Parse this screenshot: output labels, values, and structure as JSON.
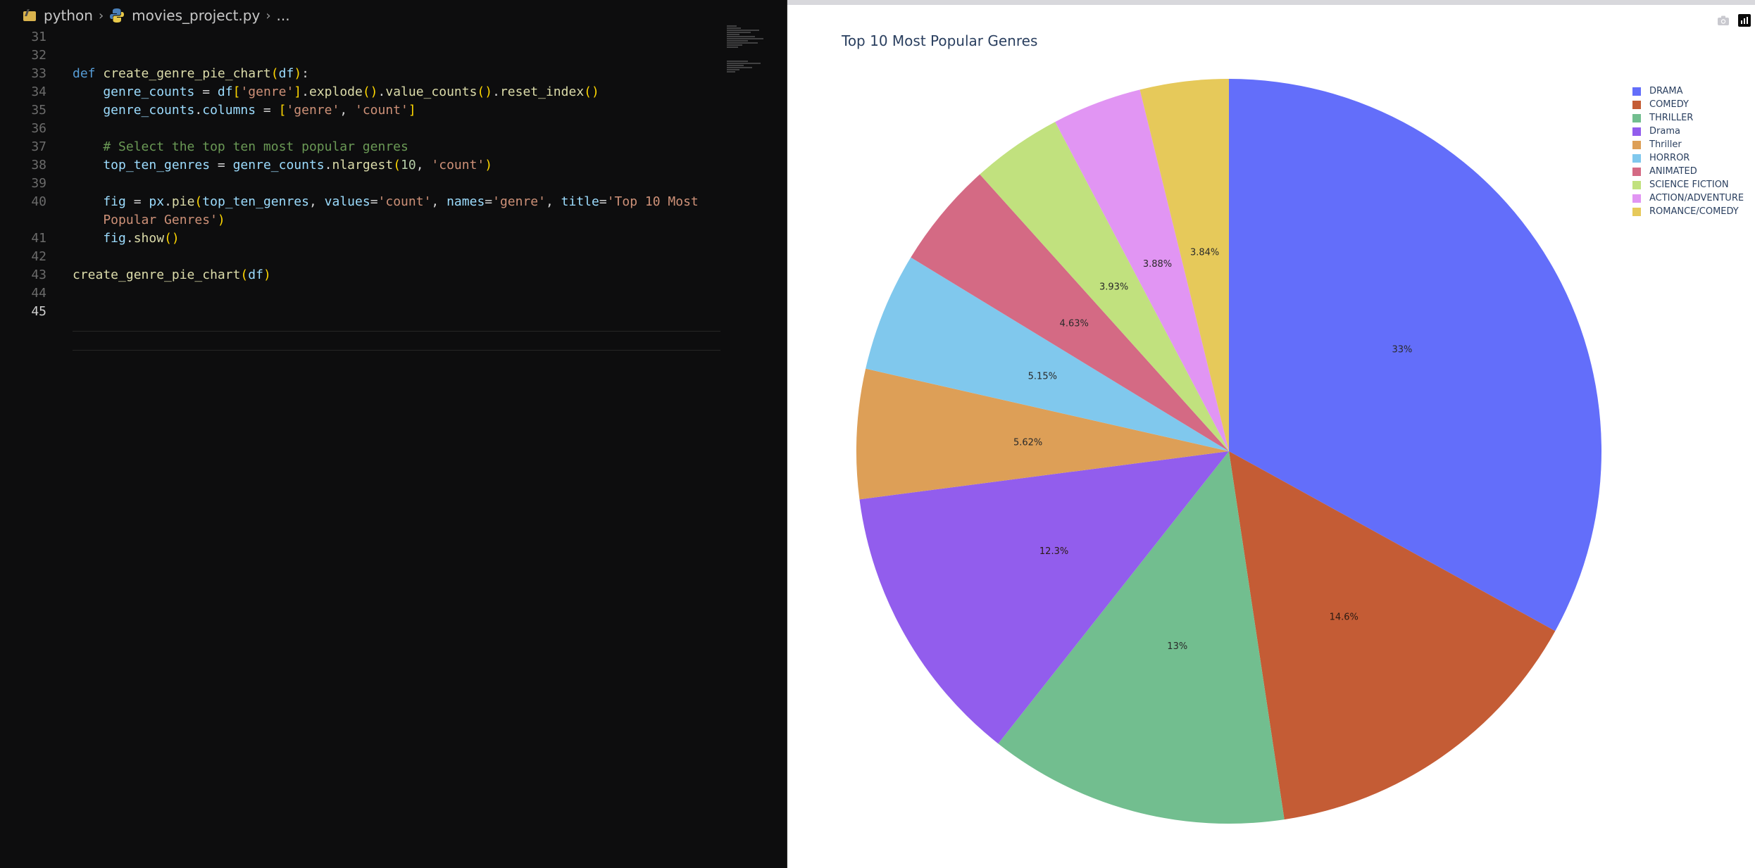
{
  "editor": {
    "breadcrumb": {
      "folder": "python",
      "file": "movies_project.py",
      "more": "..."
    },
    "active_line": "45",
    "lines": [
      {
        "num": "31",
        "tokens": []
      },
      {
        "num": "32",
        "tokens": []
      },
      {
        "num": "33",
        "tokens": [
          {
            "t": "def ",
            "c": "kw"
          },
          {
            "t": "create_genre_pie_chart",
            "c": "fn"
          },
          {
            "t": "(",
            "c": "br1"
          },
          {
            "t": "df",
            "c": "var"
          },
          {
            "t": ")",
            "c": "br1"
          },
          {
            "t": ":",
            "c": ""
          }
        ]
      },
      {
        "num": "34",
        "tokens": [
          {
            "t": "    genre_counts",
            "c": "var"
          },
          {
            "t": " = ",
            "c": ""
          },
          {
            "t": "df",
            "c": "var"
          },
          {
            "t": "[",
            "c": "br1"
          },
          {
            "t": "'genre'",
            "c": "str"
          },
          {
            "t": "]",
            "c": "br1"
          },
          {
            "t": ".",
            "c": ""
          },
          {
            "t": "explode",
            "c": "fn"
          },
          {
            "t": "()",
            "c": "br1"
          },
          {
            "t": ".",
            "c": ""
          },
          {
            "t": "value_counts",
            "c": "fn"
          },
          {
            "t": "()",
            "c": "br1"
          },
          {
            "t": ".",
            "c": ""
          },
          {
            "t": "reset_index",
            "c": "fn"
          },
          {
            "t": "()",
            "c": "br1"
          }
        ]
      },
      {
        "num": "35",
        "tokens": [
          {
            "t": "    genre_counts",
            "c": "var"
          },
          {
            "t": ".",
            "c": ""
          },
          {
            "t": "columns",
            "c": "var"
          },
          {
            "t": " = ",
            "c": ""
          },
          {
            "t": "[",
            "c": "br1"
          },
          {
            "t": "'genre'",
            "c": "str"
          },
          {
            "t": ", ",
            "c": ""
          },
          {
            "t": "'count'",
            "c": "str"
          },
          {
            "t": "]",
            "c": "br1"
          }
        ]
      },
      {
        "num": "36",
        "tokens": []
      },
      {
        "num": "37",
        "tokens": [
          {
            "t": "    # Select the top ten most popular genres",
            "c": "com"
          }
        ]
      },
      {
        "num": "38",
        "tokens": [
          {
            "t": "    top_ten_genres",
            "c": "var"
          },
          {
            "t": " = ",
            "c": ""
          },
          {
            "t": "genre_counts",
            "c": "var"
          },
          {
            "t": ".",
            "c": ""
          },
          {
            "t": "nlargest",
            "c": "fn"
          },
          {
            "t": "(",
            "c": "br1"
          },
          {
            "t": "10",
            "c": "num"
          },
          {
            "t": ", ",
            "c": ""
          },
          {
            "t": "'count'",
            "c": "str"
          },
          {
            "t": ")",
            "c": "br1"
          }
        ]
      },
      {
        "num": "39",
        "tokens": []
      },
      {
        "num": "40",
        "tokens": [
          {
            "t": "    fig",
            "c": "var"
          },
          {
            "t": " = ",
            "c": ""
          },
          {
            "t": "px",
            "c": "var"
          },
          {
            "t": ".",
            "c": ""
          },
          {
            "t": "pie",
            "c": "fn"
          },
          {
            "t": "(",
            "c": "br1"
          },
          {
            "t": "top_ten_genres",
            "c": "var"
          },
          {
            "t": ", ",
            "c": ""
          },
          {
            "t": "values",
            "c": "var"
          },
          {
            "t": "=",
            "c": ""
          },
          {
            "t": "'count'",
            "c": "str"
          },
          {
            "t": ", ",
            "c": ""
          },
          {
            "t": "names",
            "c": "var"
          },
          {
            "t": "=",
            "c": ""
          },
          {
            "t": "'genre'",
            "c": "str"
          },
          {
            "t": ", ",
            "c": ""
          },
          {
            "t": "title",
            "c": "var"
          },
          {
            "t": "=",
            "c": ""
          },
          {
            "t": "'Top 10 Most",
            "c": "str"
          }
        ]
      },
      {
        "num": "",
        "tokens": [
          {
            "t": "    Popular Genres'",
            "c": "str"
          },
          {
            "t": ")",
            "c": "br1"
          }
        ]
      },
      {
        "num": "41",
        "tokens": [
          {
            "t": "    fig",
            "c": "var"
          },
          {
            "t": ".",
            "c": ""
          },
          {
            "t": "show",
            "c": "fn"
          },
          {
            "t": "()",
            "c": "br1"
          }
        ]
      },
      {
        "num": "42",
        "tokens": []
      },
      {
        "num": "43",
        "tokens": [
          {
            "t": "create_genre_pie_chart",
            "c": "fn"
          },
          {
            "t": "(",
            "c": "br1"
          },
          {
            "t": "df",
            "c": "var"
          },
          {
            "t": ")",
            "c": "br1"
          }
        ]
      },
      {
        "num": "44",
        "tokens": []
      },
      {
        "num": "45",
        "tokens": []
      }
    ]
  },
  "chart_data": {
    "type": "pie",
    "title": "Top 10 Most Popular Genres",
    "labels": [
      "DRAMA",
      "COMEDY",
      "THRILLER",
      "Drama",
      "Thriller",
      "HORROR",
      "ANIMATED",
      "SCIENCE FICTION",
      "ACTION/ADVENTURE",
      "ROMANCE/COMEDY"
    ],
    "values": [
      33,
      14.6,
      13,
      12.3,
      5.62,
      5.15,
      4.63,
      3.93,
      3.88,
      3.84
    ],
    "text_labels": [
      "33%",
      "14.6%",
      "13%",
      "12.3%",
      "5.62%",
      "5.15%",
      "4.63%",
      "3.93%",
      "3.88%",
      "3.84%"
    ],
    "colors": [
      "#636efa",
      "#c45c35",
      "#72be8f",
      "#925ded",
      "#dd9f57",
      "#80c8ed",
      "#d46a84",
      "#c1e17e",
      "#e195f3",
      "#e6c95a"
    ],
    "legend_position": "top-right",
    "sort": "descending, clockwise from top"
  }
}
